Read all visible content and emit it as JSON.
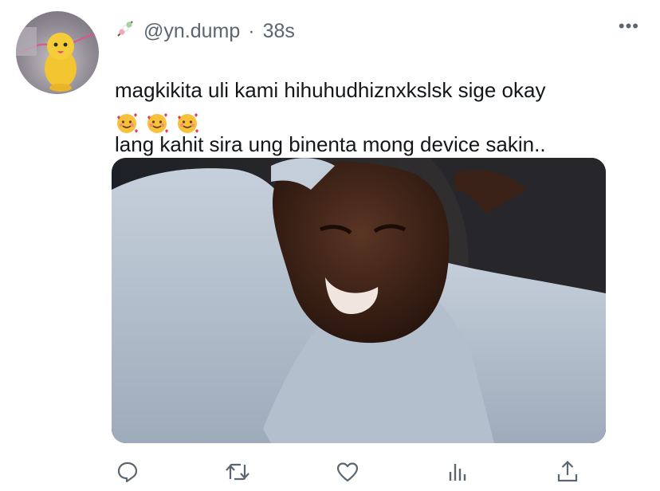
{
  "tweet": {
    "handle": "@yn.dump",
    "separator": "·",
    "time": "38s",
    "text_line1": "magkikita uli kami hihuhudhiznxkslsk sige okay",
    "text_line2": "lang kahit sira ung binenta mong device sakin..",
    "emojis": [
      "🥰",
      "🥰",
      "🥰"
    ],
    "more_label": "•••"
  },
  "icons": {
    "name_emoji": "skewer-icon",
    "reply": "reply-icon",
    "retweet": "retweet-icon",
    "like": "heart-icon",
    "analytics": "analytics-icon",
    "share": "share-icon"
  },
  "colors": {
    "text": "#14171a",
    "muted": "#5b6670",
    "icon": "#5b6670"
  }
}
